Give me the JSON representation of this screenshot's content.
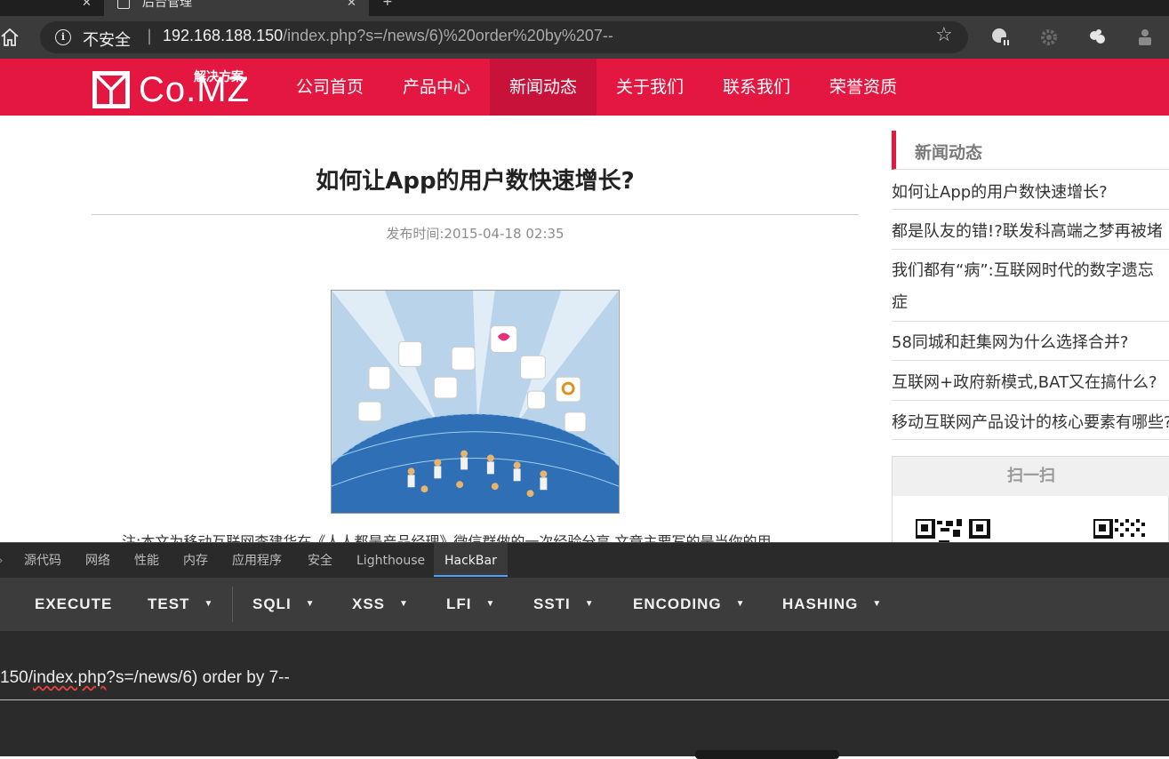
{
  "browser": {
    "tab_title": "后台管理",
    "security_label": "不安全",
    "url_host": "192.168.188.150",
    "url_path": "/index.php?s=/news/6)%20order%20by%207--"
  },
  "site": {
    "logo_text": "Co.MZ",
    "logo_sub": "解决方案",
    "brand_color": "#e3173f",
    "nav": [
      {
        "label": "公司首页"
      },
      {
        "label": "产品中心"
      },
      {
        "label": "新闻动态"
      },
      {
        "label": "关于我们"
      },
      {
        "label": "联系我们"
      },
      {
        "label": "荣誉资质"
      }
    ],
    "active_nav": "新闻动态"
  },
  "article": {
    "title": "如何让App的用户数快速增长?",
    "publish_label": "发布时间:2015-04-18 02:35",
    "excerpt": "注:本文为移动互联网李建华在《人人都是产品经理》微信群做的一次经验分享,文章主要写的是当你的用"
  },
  "sidebar": {
    "heading": "新闻动态",
    "items": [
      {
        "label": "如何让App的用户数快速增长?"
      },
      {
        "label": "都是队友的错!?联发科高端之梦再被堵"
      },
      {
        "label": "我们都有“病”:互联网时代的数字遗忘症"
      },
      {
        "label": "58同城和赶集网为什么选择合并?"
      },
      {
        "label": "互联网+政府新模式,BAT又在搞什么?"
      },
      {
        "label": "移动互联网产品设计的核心要素有哪些?"
      }
    ],
    "qr_heading": "扫一扫"
  },
  "devtools": {
    "tabs": [
      {
        "label": "源代码"
      },
      {
        "label": "网络"
      },
      {
        "label": "性能"
      },
      {
        "label": "内存"
      },
      {
        "label": "应用程序"
      },
      {
        "label": "安全"
      },
      {
        "label": "Lighthouse"
      },
      {
        "label": "HackBar"
      }
    ],
    "active_tab": "HackBar"
  },
  "hackbar": {
    "buttons": [
      {
        "label": "EXECUTE"
      },
      {
        "label": "TEST"
      },
      {
        "label": "SQLI"
      },
      {
        "label": "XSS"
      },
      {
        "label": "LFI"
      },
      {
        "label": "SSTI"
      },
      {
        "label": "ENCODING"
      },
      {
        "label": "HASHING"
      }
    ],
    "url_prefix": "150/",
    "url_underlined": "index.php",
    "url_suffix": "?s=/news/6) order by 7--"
  }
}
